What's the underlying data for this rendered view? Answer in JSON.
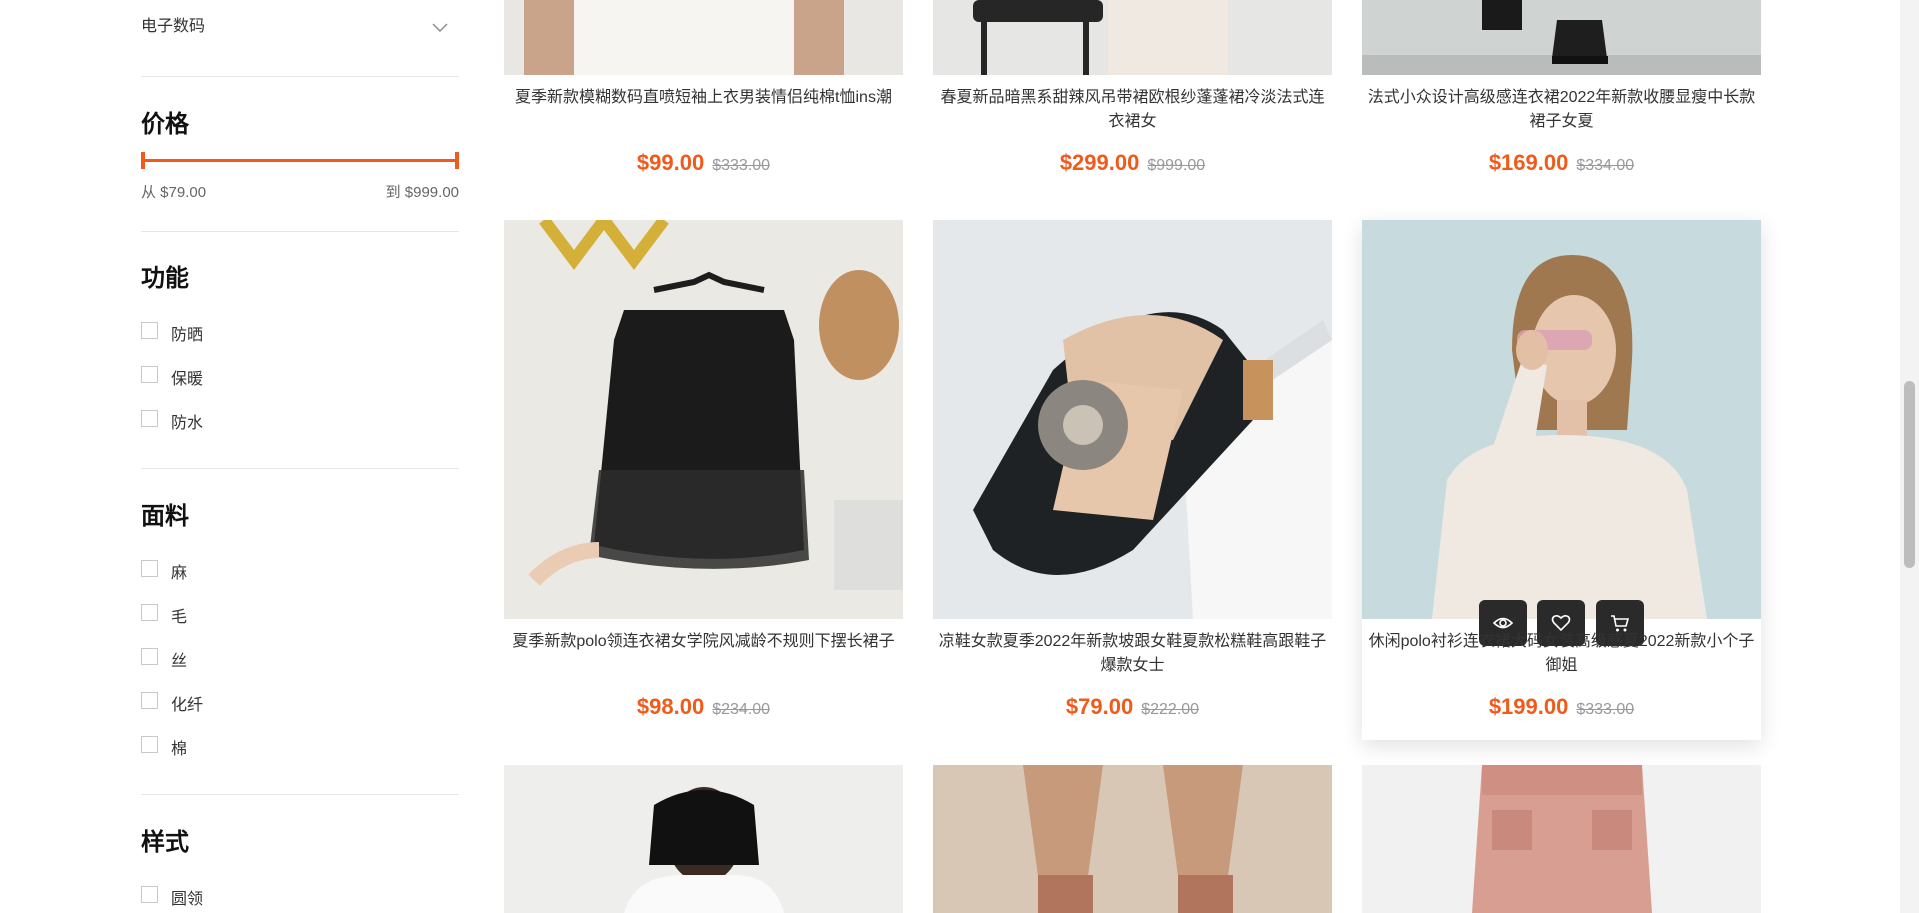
{
  "filters": {
    "category": {
      "label": "电子数码",
      "icon": "chevron-down-icon"
    },
    "price": {
      "title": "价格",
      "from_label": "从 $79.00",
      "to_label": "到 $999.00",
      "min_value": 79,
      "max_value": 999,
      "accent": "#f05a1a"
    },
    "function": {
      "title": "功能",
      "options": [
        {
          "label": "防晒",
          "checked": false
        },
        {
          "label": "保暖",
          "checked": false
        },
        {
          "label": "防水",
          "checked": false
        }
      ]
    },
    "fabric": {
      "title": "面料",
      "options": [
        {
          "label": "麻",
          "checked": false
        },
        {
          "label": "毛",
          "checked": false
        },
        {
          "label": "丝",
          "checked": false
        },
        {
          "label": "化纤",
          "checked": false
        },
        {
          "label": "棉",
          "checked": false
        }
      ]
    },
    "style": {
      "title": "样式",
      "options": [
        {
          "label": "圆领",
          "checked": false
        }
      ]
    }
  },
  "products": [
    {
      "title": "夏季新款模糊数码直喷短袖上衣男装情侣纯棉t恤ins潮",
      "price": "$99.00",
      "old_price": "$333.00"
    },
    {
      "title": "春夏新品暗黑系甜辣风吊带裙欧根纱蓬蓬裙冷淡法式连衣裙女",
      "price": "$299.00",
      "old_price": "$999.00"
    },
    {
      "title": "法式小众设计高级感连衣裙2022年新款收腰显瘦中长款裙子女夏",
      "price": "$169.00",
      "old_price": "$334.00"
    },
    {
      "title": "夏季新款polo领连衣裙女学院风减龄不规则下摆长裙子",
      "price": "$98.00",
      "old_price": "$234.00"
    },
    {
      "title": "凉鞋女款夏季2022年新款坡跟女鞋夏款松糕鞋高跟鞋子爆款女士",
      "price": "$79.00",
      "old_price": "$222.00"
    },
    {
      "title": "休闲polo衬衫连衣裙大码女装高级感夏2022新款小个子御姐",
      "price": "$199.00",
      "old_price": "$333.00"
    }
  ],
  "product_actions": [
    "eye-icon",
    "heart-icon",
    "cart-icon"
  ]
}
